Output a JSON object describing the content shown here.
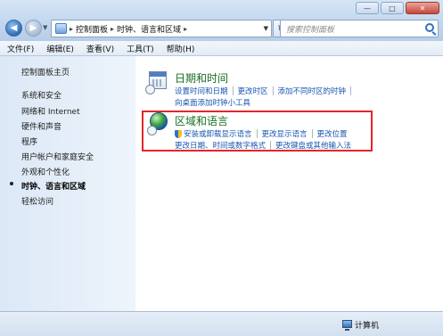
{
  "window": {
    "controls": {
      "minimize": "—",
      "maximize": "□",
      "close": "✕"
    }
  },
  "address_bar": {
    "crumbs": [
      "控制面板",
      "时钟、语言和区域"
    ],
    "search_placeholder": "搜索控制面板"
  },
  "menu": {
    "items": [
      "文件(F)",
      "编辑(E)",
      "查看(V)",
      "工具(T)",
      "帮助(H)"
    ]
  },
  "sidebar": {
    "home": "控制面板主页",
    "items": [
      "系统和安全",
      "网络和 Internet",
      "硬件和声音",
      "程序",
      "用户帐户和家庭安全",
      "外观和个性化",
      "时钟、语言和区域",
      "轻松访问"
    ],
    "active_index": 6
  },
  "categories": [
    {
      "title": "日期和时间",
      "tasks_row1": [
        "设置时间和日期",
        "更改时区",
        "添加不同时区的时钟"
      ],
      "tasks_row2": [
        "向桌面添加时钟小工具"
      ]
    },
    {
      "title": "区域和语言",
      "tasks_row1": [
        "安装或卸载显示语言",
        "更改显示语言",
        "更改位置"
      ],
      "tasks_row2": [
        "更改日期、时间或数字格式",
        "更改键盘或其他输入法"
      ]
    }
  ],
  "status_bar": {
    "text": "计算机"
  },
  "colors": {
    "highlight": "#e2262b",
    "category_title": "#1a6e22",
    "task_link": "#1656b0"
  },
  "icons": {
    "calendar": "calendar-icon",
    "globe": "globe-icon",
    "shield": "uac-shield-icon",
    "computer": "computer-icon",
    "search": "search-icon"
  }
}
